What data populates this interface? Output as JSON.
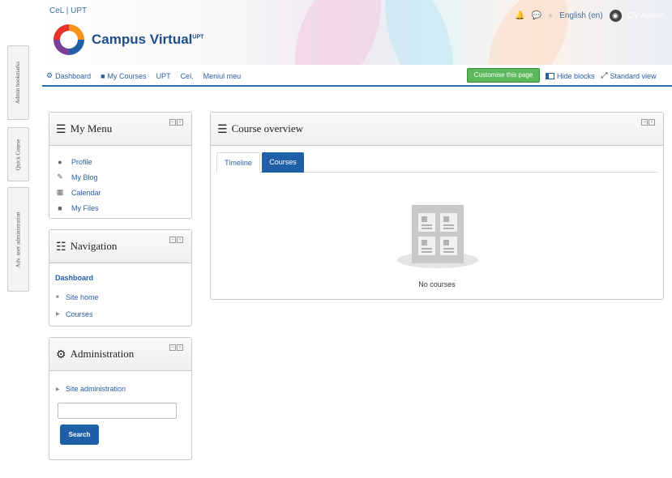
{
  "dock": {
    "tabs": [
      {
        "label": "Admin bookmarks"
      },
      {
        "label": "Quick Course"
      },
      {
        "label": "Adv. user administration"
      }
    ]
  },
  "header": {
    "site_link": "CeL | UPT",
    "logo_text": "Campus Virtual",
    "logo_sup": "UPT",
    "language": "English (en)",
    "user_name": "CV Admin"
  },
  "navbar": {
    "items": [
      {
        "label": "Dashboard",
        "icon": "dashboard-icon"
      },
      {
        "label": "My Courses",
        "icon": "briefcase-icon"
      },
      {
        "label": "UPT"
      },
      {
        "label": "Cel."
      },
      {
        "label": "Meniul meu"
      }
    ],
    "customise_label": "Customise this page",
    "hide_blocks_label": "Hide blocks",
    "standard_view_label": "Standard view"
  },
  "my_menu": {
    "title": "My Menu",
    "items": [
      {
        "label": "Profile",
        "icon": "user-icon"
      },
      {
        "label": "My Blog",
        "icon": "edit-icon"
      },
      {
        "label": "Calendar",
        "icon": "calendar-icon"
      },
      {
        "label": "My Files",
        "icon": "folder-icon"
      }
    ]
  },
  "navigation": {
    "title": "Navigation",
    "dashboard": "Dashboard",
    "items": [
      {
        "label": "Site home"
      },
      {
        "label": "Courses"
      }
    ]
  },
  "administration": {
    "title": "Administration",
    "site_admin": "Site administration",
    "search_value": "",
    "search_label": "Search"
  },
  "course_overview": {
    "title": "Course overview",
    "tabs": [
      {
        "label": "Timeline",
        "active": false
      },
      {
        "label": "Courses",
        "active": true
      }
    ],
    "empty_message": "No courses"
  },
  "colors": {
    "primary": "#1f5fa8",
    "customise_green": "#5cb85c",
    "link": "#2a5ea5"
  }
}
